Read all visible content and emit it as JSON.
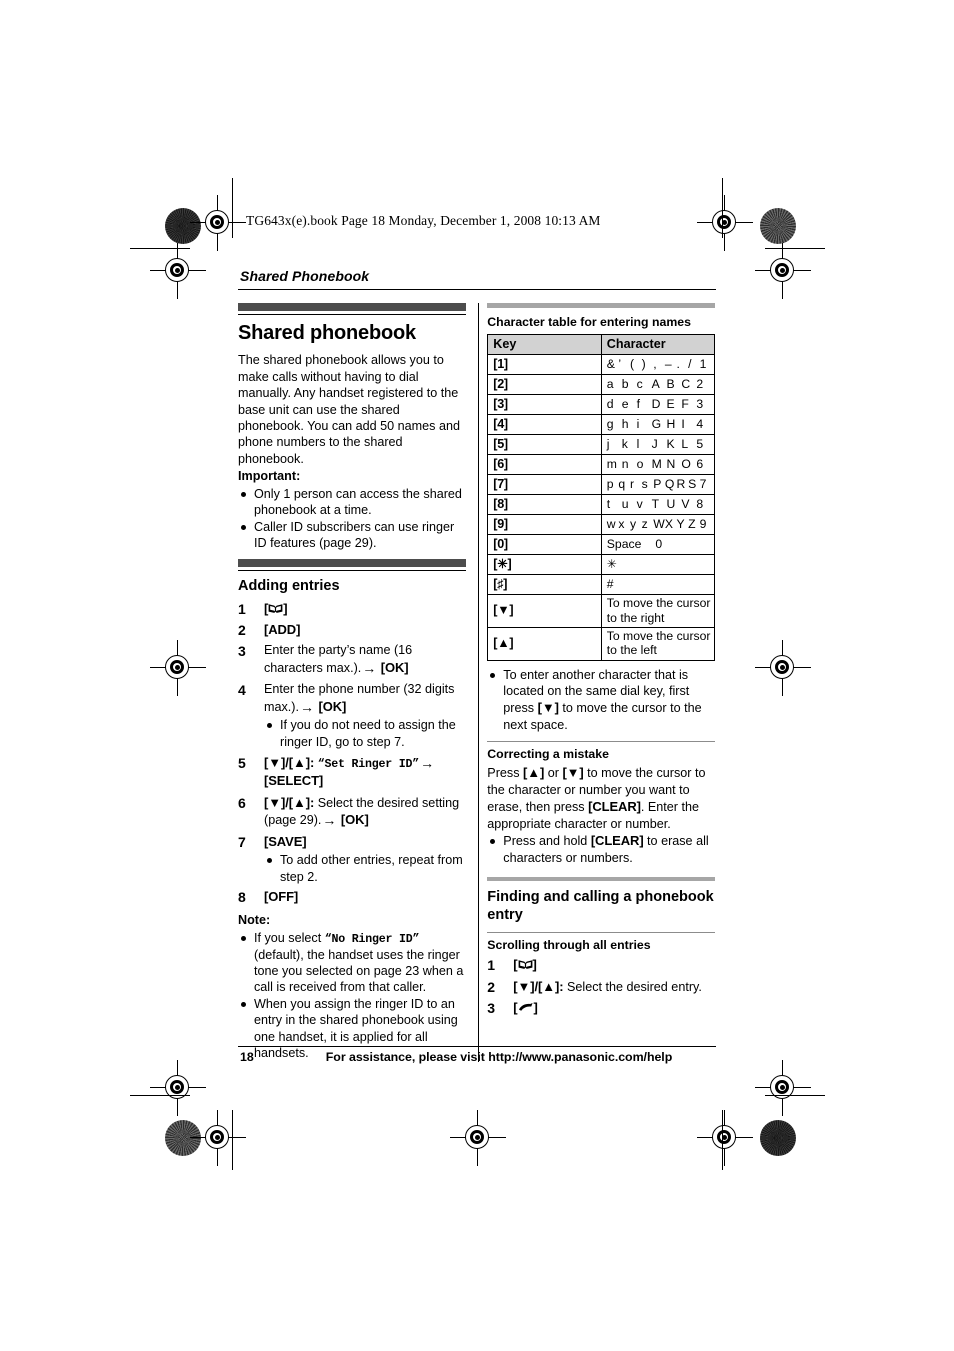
{
  "print_slug": "TG643x(e).book  Page 18  Monday, December 1, 2008  10:13 AM",
  "chapter": "Shared Phonebook",
  "left_column": {
    "section_title": "Shared phonebook",
    "intro": "The shared phonebook allows you to make calls without having to dial manually. Any handset registered to the base unit can use the shared phonebook. You can add 50 names and phone numbers to the shared phonebook.",
    "important_label": "Important:",
    "important_bullets": [
      "Only 1 person can access the shared phonebook at a time.",
      "Caller ID subscribers can use ringer ID features (page 29)."
    ],
    "adding_entries_title": "Adding entries",
    "steps": [
      {
        "num": "1",
        "key_icon": "phonebook-book-icon",
        "text": ""
      },
      {
        "num": "2",
        "key": "[ADD]",
        "text": ""
      },
      {
        "num": "3",
        "text": "Enter the party’s name (16 characters max.).",
        "arrow": "→",
        "key_after": "[OK]"
      },
      {
        "num": "4",
        "text": "Enter the phone number (32 digits max.).",
        "arrow": "→",
        "key_after": "[OK]",
        "subbullets": [
          "If you do not need to assign the ringer ID, go to step 7."
        ]
      },
      {
        "num": "5",
        "nav_keys": "[▼]/[▲]:",
        "quoted_mono": "“Set Ringer ID”",
        "arrow": "→",
        "key_after": "[SELECT]"
      },
      {
        "num": "6",
        "nav_keys": "[▼]/[▲]:",
        "text": "Select the desired setting (page 29).",
        "arrow": "→",
        "key_after": "[OK]"
      },
      {
        "num": "7",
        "key": "[SAVE]",
        "subbullets": [
          "To add other entries, repeat from step 2."
        ]
      },
      {
        "num": "8",
        "key": "[OFF]",
        "text": ""
      }
    ],
    "note_label": "Note:",
    "note_bullets": [
      {
        "pre": "If you select ",
        "mono": "“No Ringer ID”",
        "post": " (default), the handset uses the ringer tone you selected on page 23 when a call is received from that caller."
      },
      {
        "pre": "When you assign the ringer ID to an entry in the shared phonebook using one handset, it is applied for all handsets.",
        "mono": "",
        "post": ""
      }
    ]
  },
  "right_column": {
    "char_table_title": "Character table for entering names",
    "table_headers": [
      "Key",
      "Character"
    ],
    "table_rows": [
      {
        "key": "[1]",
        "chars": [
          "&",
          "’",
          "(",
          ")",
          ",",
          "–",
          ".",
          "/",
          "1"
        ],
        "desc": ""
      },
      {
        "key": "[2]",
        "chars": [
          "a",
          "b",
          "c",
          "A",
          "B",
          "C",
          "2"
        ],
        "desc": ""
      },
      {
        "key": "[3]",
        "chars": [
          "d",
          "e",
          "f",
          "D",
          "E",
          "F",
          "3"
        ],
        "desc": ""
      },
      {
        "key": "[4]",
        "chars": [
          "g",
          "h",
          "i",
          "G",
          "H",
          "I",
          "4"
        ],
        "desc": ""
      },
      {
        "key": "[5]",
        "chars": [
          "j",
          "k",
          "l",
          "J",
          "K",
          "L",
          "5"
        ],
        "desc": ""
      },
      {
        "key": "[6]",
        "chars": [
          "m",
          "n",
          "o",
          "M",
          "N",
          "O",
          "6"
        ],
        "desc": ""
      },
      {
        "key": "[7]",
        "chars": [
          "p",
          "q",
          "r",
          "s",
          "P",
          "Q",
          "R",
          "S",
          "7"
        ],
        "desc": ""
      },
      {
        "key": "[8]",
        "chars": [
          "t",
          "u",
          "v",
          "T",
          "U",
          "V",
          "8"
        ],
        "desc": ""
      },
      {
        "key": "[9]",
        "chars": [
          "w",
          "x",
          "y",
          "z",
          "W",
          "X",
          "Y",
          "Z",
          "9"
        ],
        "desc": ""
      },
      {
        "key": "[0]",
        "chars": [
          "Space",
          "0"
        ],
        "desc": "",
        "wide": true
      },
      {
        "key": "[✳]",
        "chars": [
          "✳"
        ],
        "desc": "",
        "wide": true
      },
      {
        "key": "[♯]",
        "chars": [
          "#"
        ],
        "desc": "",
        "wide": true
      },
      {
        "key": "[▼]",
        "chars": [],
        "desc": "To move the cursor to the right"
      },
      {
        "key": "[▲]",
        "chars": [],
        "desc": "To move the cursor to the left"
      }
    ],
    "after_table_bullet": {
      "pre": "To enter another character that is located on the same dial key, first press ",
      "key": "[▼]",
      "post": " to move the cursor to the next space."
    },
    "correcting_title": "Correcting a mistake",
    "correcting_text": {
      "p1a": "Press ",
      "k1": "[▲]",
      "p1b": " or ",
      "k2": "[▼]",
      "p1c": " to move the cursor to the character or number you want to erase, then press ",
      "k3": "[CLEAR]",
      "p1d": ". Enter the appropriate character or number."
    },
    "correcting_bullet": {
      "pre": "Press and hold ",
      "key": "[CLEAR]",
      "post": " to erase all characters or numbers."
    },
    "finding_title": "Finding and calling a phonebook entry",
    "scrolling_title": "Scrolling through all entries",
    "scrolling_steps": [
      {
        "num": "1",
        "key_icon": "phonebook-book-icon"
      },
      {
        "num": "2",
        "nav_keys": "[▼]/[▲]:",
        "text": "Select the desired entry."
      },
      {
        "num": "3",
        "key_icon": "talk-handset-icon"
      }
    ]
  },
  "footer": {
    "page_number": "18",
    "assistance": "For assistance, please visit http://www.panasonic.com/help"
  }
}
